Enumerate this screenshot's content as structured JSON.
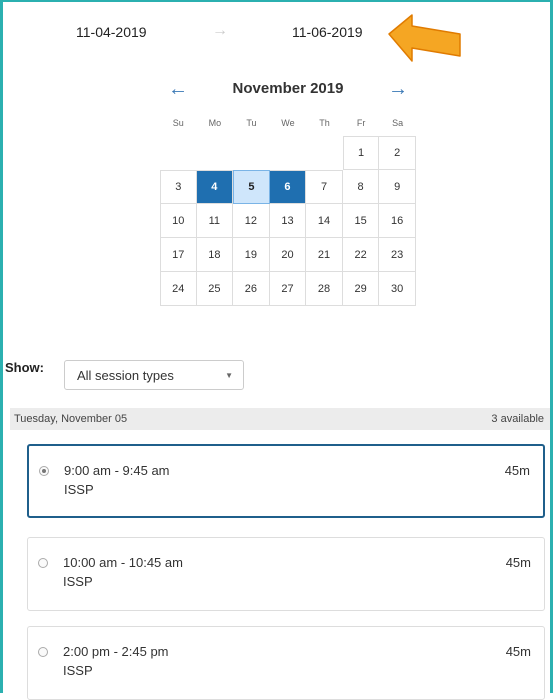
{
  "date_range": {
    "start": "11-04-2019",
    "arrow": "→",
    "end": "11-06-2019"
  },
  "calendar": {
    "prev_icon": "←",
    "next_icon": "→",
    "month_title": "November 2019",
    "weekdays": [
      "Su",
      "Mo",
      "Tu",
      "We",
      "Th",
      "Fr",
      "Sa"
    ],
    "weeks": [
      [
        "",
        "",
        "",
        "",
        "",
        "1",
        "2"
      ],
      [
        "3",
        "4",
        "5",
        "6",
        "7",
        "8",
        "9"
      ],
      [
        "10",
        "11",
        "12",
        "13",
        "14",
        "15",
        "16"
      ],
      [
        "17",
        "18",
        "19",
        "20",
        "21",
        "22",
        "23"
      ],
      [
        "24",
        "25",
        "26",
        "27",
        "28",
        "29",
        "30"
      ]
    ],
    "selected": [
      "4",
      "6"
    ],
    "highlighted": "5"
  },
  "filter": {
    "label": "Show:",
    "value": "All session types",
    "caret": "▼"
  },
  "day": {
    "date": "Tuesday, November 05",
    "available": "3 available"
  },
  "slots": [
    {
      "time": "9:00 am - 9:45 am",
      "service": "ISSP",
      "duration": "45m",
      "selected": true
    },
    {
      "time": "10:00 am - 10:45 am",
      "service": "ISSP",
      "duration": "45m",
      "selected": false
    },
    {
      "time": "2:00 pm - 2:45 pm",
      "service": "ISSP",
      "duration": "45m",
      "selected": false
    }
  ],
  "colors": {
    "accent": "#1f6fb0",
    "frame": "#2bb0b0",
    "callout": "#f5a623"
  }
}
